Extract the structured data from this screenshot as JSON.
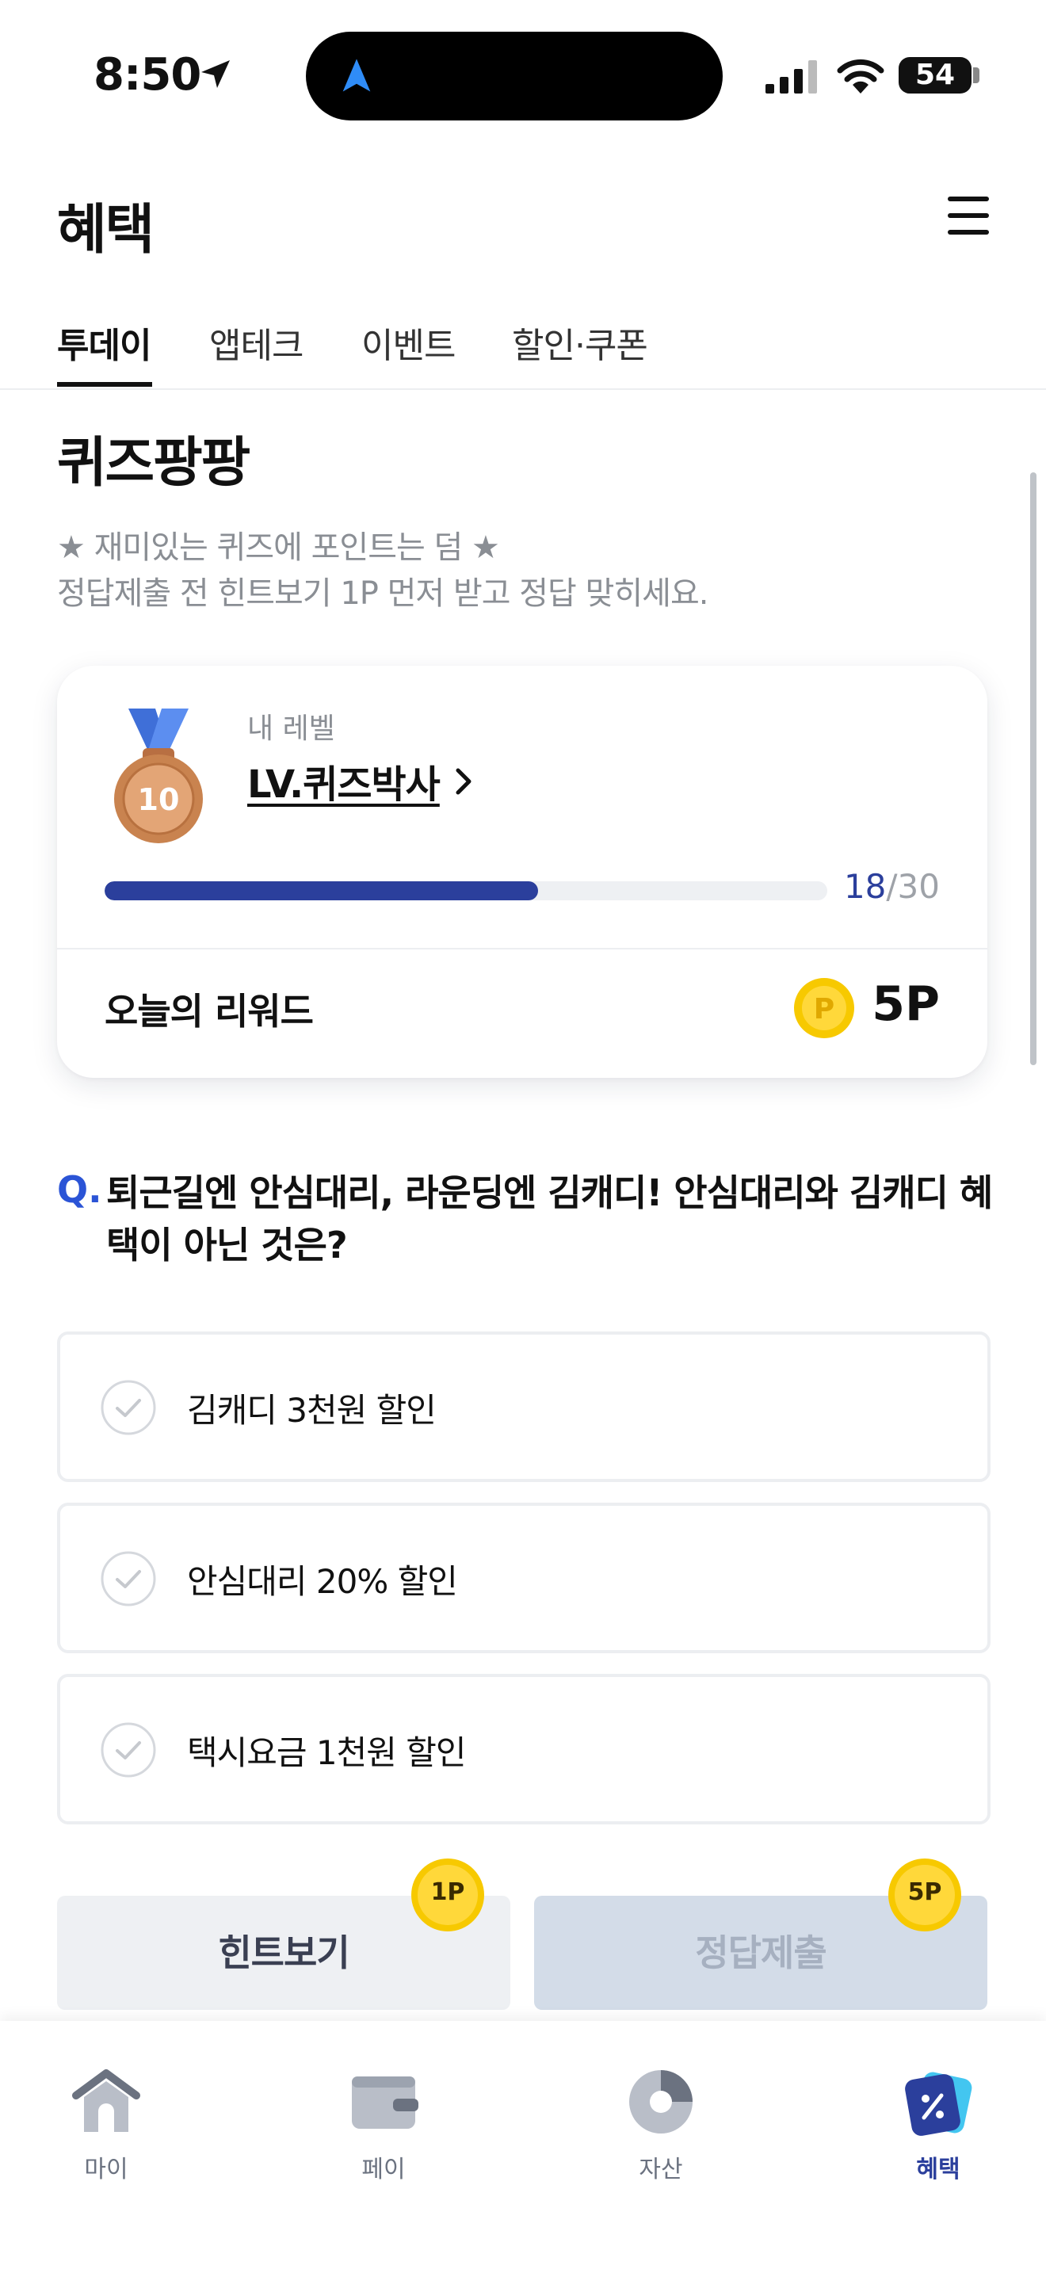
{
  "status_bar": {
    "time": "8:50",
    "battery": "54"
  },
  "header": {
    "title": "혜택",
    "menu_icon": "hamburger-menu-icon"
  },
  "tabs": [
    {
      "label": "투데이",
      "active": true
    },
    {
      "label": "앱테크",
      "active": false
    },
    {
      "label": "이벤트",
      "active": false
    },
    {
      "label": "할인·쿠폰",
      "active": false
    }
  ],
  "quiz": {
    "title": "퀴즈팡팡",
    "desc_line1": "★ 재미있는 퀴즈에 포인트는 덤 ★",
    "desc_line2": "정답제출 전 힌트보기 1P 먼저 받고 정답 맞히세요."
  },
  "level_card": {
    "caption": "내 레벨",
    "level_name": "LV.퀴즈박사",
    "medal_number": "10",
    "progress_current": "18",
    "progress_separator": "/",
    "progress_total": "30",
    "progress_fraction": 0.6,
    "reward_label": "오늘의 리워드",
    "reward_value": "5P",
    "coin_letter": "P"
  },
  "question": {
    "prefix": "Q.",
    "text": "퇴근길엔 안심대리, 라운딩엔 김캐디! 안심대리와 김캐디 혜택이 아닌 것은?",
    "options": [
      "김캐디 3천원 할인",
      "안심대리 20% 할인",
      "택시요금 1천원 할인"
    ]
  },
  "actions": {
    "hint_label": "힌트보기",
    "hint_badge": "1P",
    "submit_label": "정답제출",
    "submit_badge": "5P"
  },
  "bottom_nav": [
    {
      "label": "마이",
      "icon": "home-icon",
      "active": false
    },
    {
      "label": "페이",
      "icon": "wallet-icon",
      "active": false
    },
    {
      "label": "자산",
      "icon": "pie-chart-icon",
      "active": false
    },
    {
      "label": "혜택",
      "icon": "discount-tag-icon",
      "active": true
    }
  ],
  "colors": {
    "accent": "#2b3f9c",
    "question_accent": "#2b54d6",
    "coin": "#f5c400",
    "submit_disabled": "#d3dce8"
  }
}
